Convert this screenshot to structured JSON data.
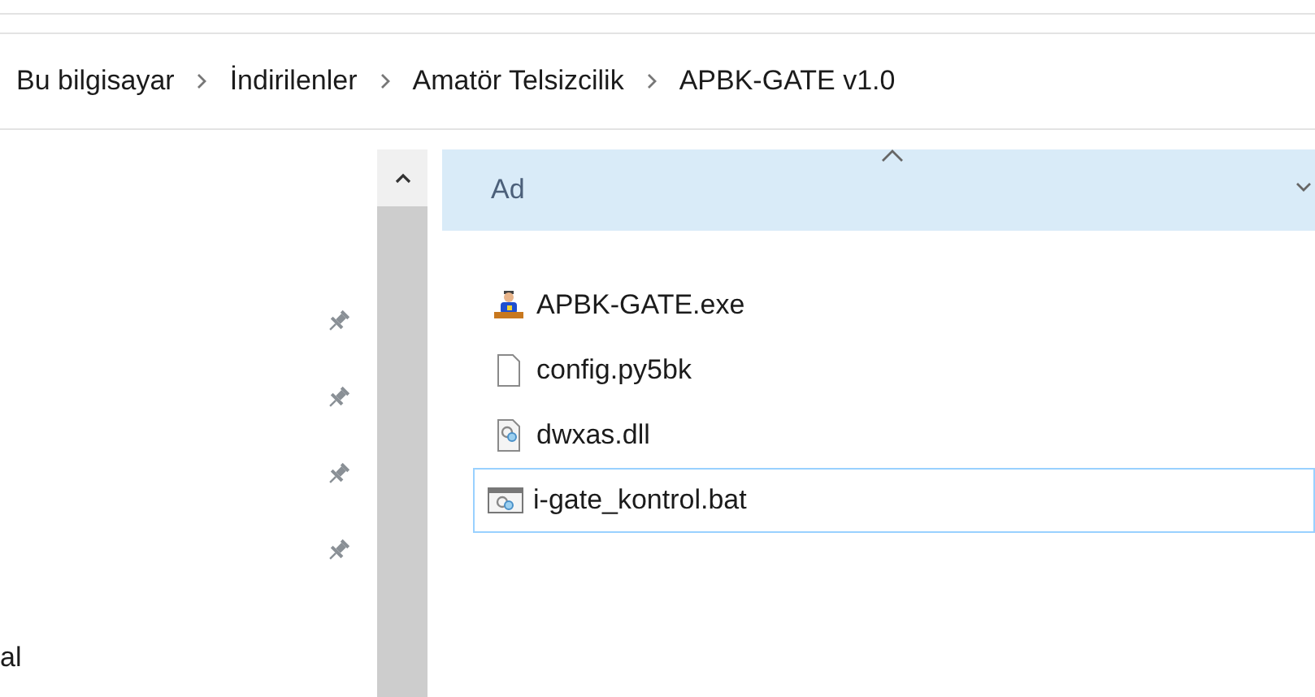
{
  "breadcrumb": [
    "Bu bilgisayar",
    "İndirilenler",
    "Amatör Telsizcilik",
    "APBK-GATE v1.0"
  ],
  "nav_pane": {
    "items": [
      {
        "kind": "pinned"
      },
      {
        "kind": "pinned"
      },
      {
        "kind": "pinned"
      },
      {
        "kind": "pinned"
      }
    ],
    "cut_label": "al"
  },
  "file_list": {
    "column": "Ad",
    "files": [
      {
        "name": "APBK-GATE.exe",
        "kind": "app",
        "selected": false
      },
      {
        "name": "config.py5bk",
        "kind": "blank",
        "selected": false
      },
      {
        "name": "dwxas.dll",
        "kind": "settings",
        "selected": false
      },
      {
        "name": "i-gate_kontrol.bat",
        "kind": "batch",
        "selected": true
      }
    ]
  }
}
